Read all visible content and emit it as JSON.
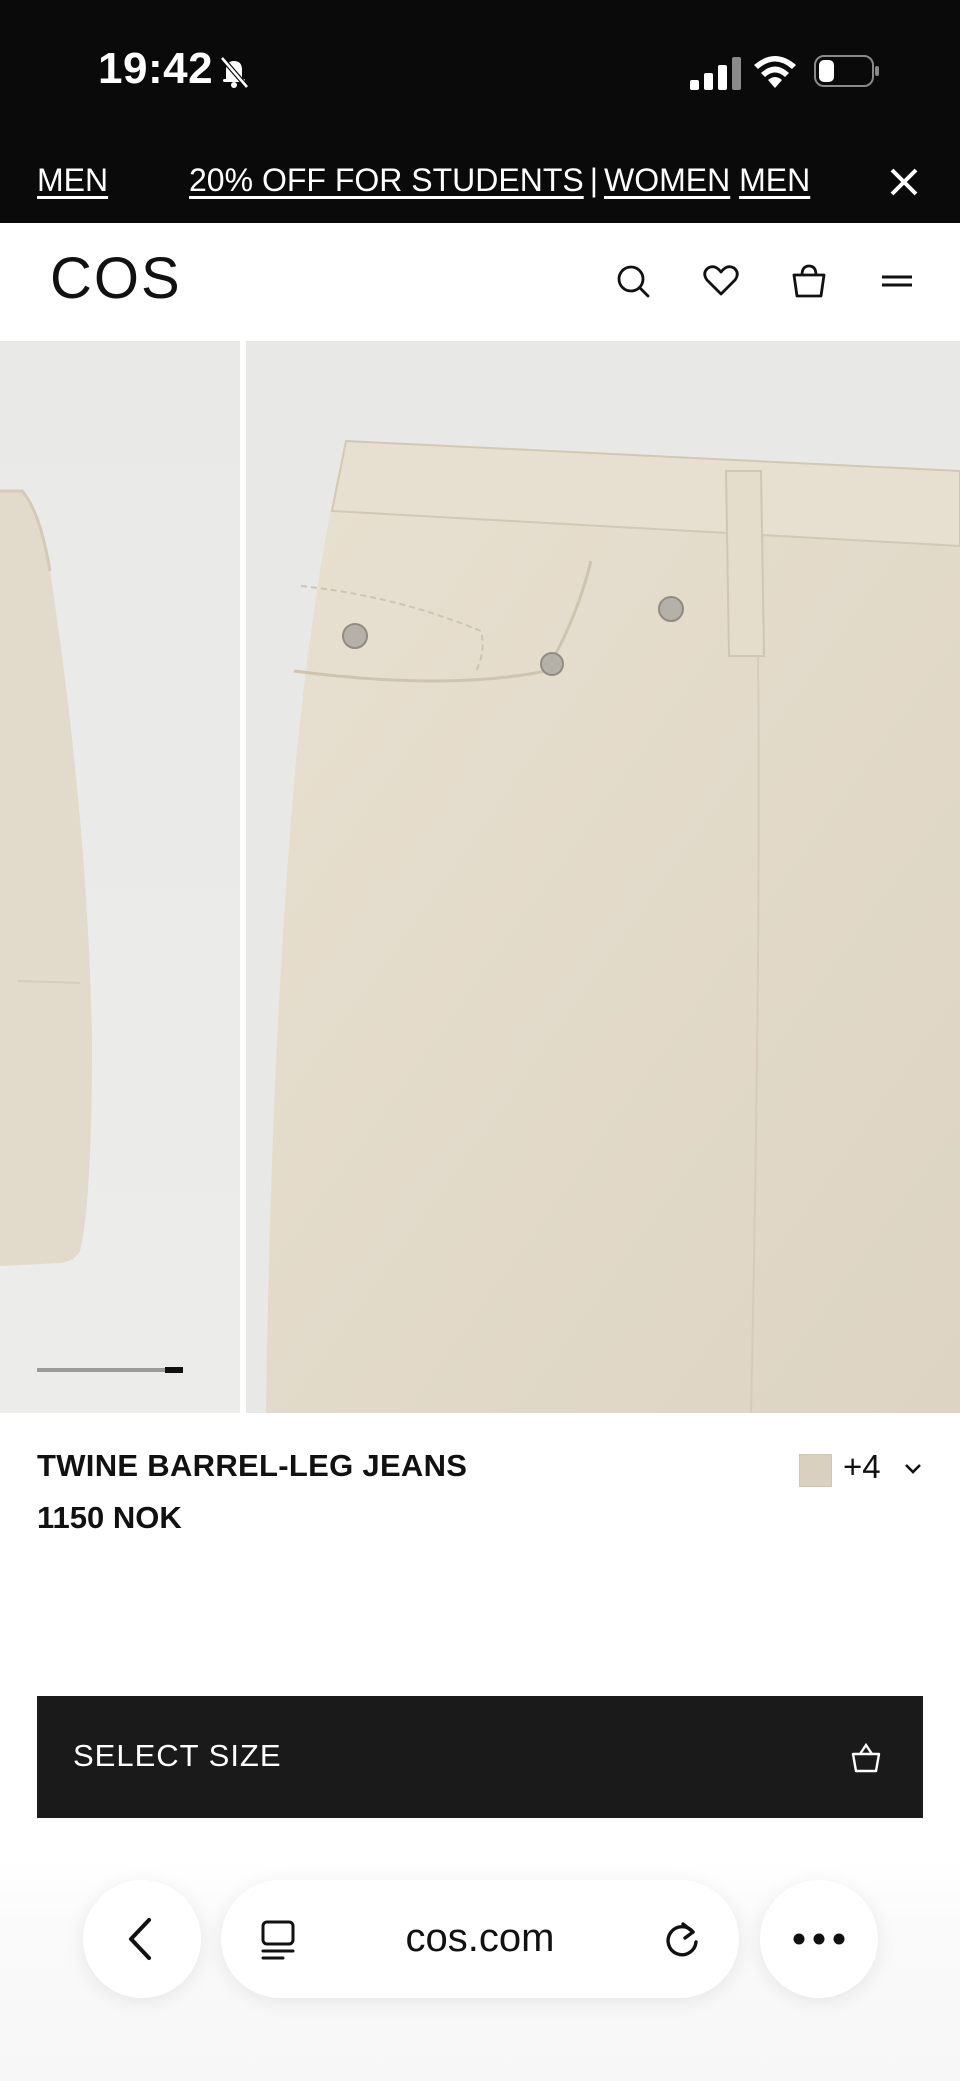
{
  "status_bar": {
    "time": "19:42",
    "icons": [
      "bell-slash-icon",
      "signal-icon",
      "wifi-icon",
      "battery-icon"
    ]
  },
  "promo_banner": {
    "men_left": "MEN",
    "students": "20% OFF FOR STUDENTS",
    "separator": "|",
    "women": "WOMEN",
    "men_right": "MEN",
    "close_icon": "close-icon"
  },
  "header": {
    "logo": "COS",
    "icons": [
      "search-icon",
      "heart-icon",
      "shopping-bag-icon",
      "menu-icon"
    ]
  },
  "gallery": {
    "progress_fraction": 0.12,
    "expand_icon": "expand-icon",
    "favourite_icon": "heart-icon"
  },
  "product": {
    "title": "TWINE BARREL-LEG JEANS",
    "price": "1150 NOK",
    "swatch_color": "#d9d0c0",
    "more_colors": "+4"
  },
  "cta": {
    "label": "SELECT SIZE"
  },
  "browser": {
    "url": "cos.com"
  },
  "colors": {
    "banner_bg": "#0a0a0a",
    "cta_bg": "#1a1a1a",
    "fabric": "#e4dccd"
  }
}
